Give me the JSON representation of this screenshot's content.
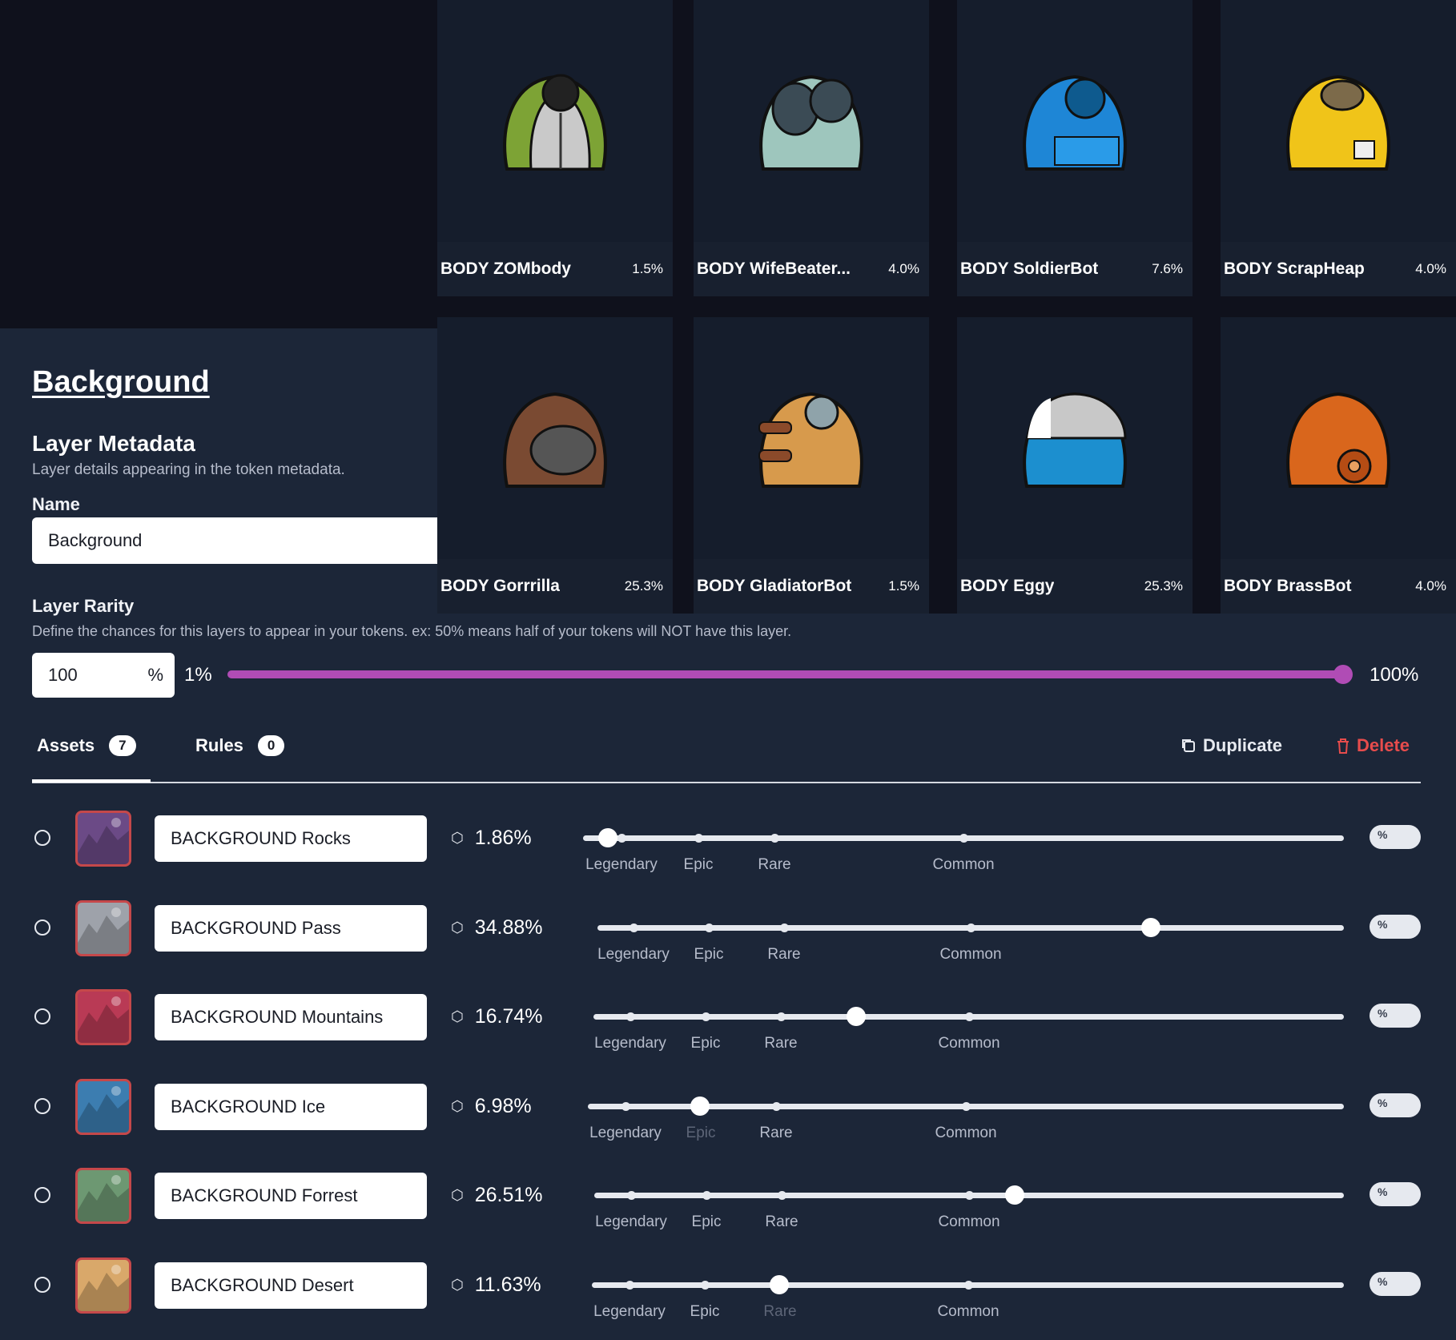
{
  "cards": [
    {
      "name": "BODY ZOMbody",
      "pct": "1.5%"
    },
    {
      "name": "BODY WifeBeater...",
      "pct": "4.0%"
    },
    {
      "name": "BODY SoldierBot",
      "pct": "7.6%"
    },
    {
      "name": "BODY ScrapHeap",
      "pct": "4.0%"
    },
    {
      "name": "BODY Gorrrilla",
      "pct": "25.3%"
    },
    {
      "name": "BODY GladiatorBot",
      "pct": "1.5%"
    },
    {
      "name": "BODY Eggy",
      "pct": "25.3%"
    },
    {
      "name": "BODY BrassBot",
      "pct": "4.0%"
    }
  ],
  "layer": {
    "title": "Background",
    "metadata_heading": "Layer Metadata",
    "metadata_sub": "Layer details appearing in the token metadata.",
    "name_label": "Name",
    "name_value": "Background",
    "rarity_label": "Layer Rarity",
    "rarity_desc": "Define the chances for this layers to appear in your tokens. ex: 50% means half of your tokens will NOT have this layer.",
    "rarity_value": "100",
    "rarity_unit": "%",
    "range_min": "1%",
    "range_max": "100%"
  },
  "tabs": {
    "assets_label": "Assets",
    "assets_count": "7",
    "rules_label": "Rules",
    "rules_count": "0",
    "duplicate_label": "Duplicate",
    "delete_label": "Delete"
  },
  "tier_labels": [
    "Legendary",
    "Epic",
    "Rare",
    "Common"
  ],
  "toggle_label": "%",
  "assets": [
    {
      "name": "BACKGROUND Rocks",
      "rarity": "1.86%",
      "color": "#6b4a86"
    },
    {
      "name": "BACKGROUND Pass",
      "rarity": "34.88%",
      "color": "#9ea2aa"
    },
    {
      "name": "BACKGROUND Mountains",
      "rarity": "16.74%",
      "color": "#b93a55"
    },
    {
      "name": "BACKGROUND Ice",
      "rarity": "6.98%",
      "color": "#3c7db0"
    },
    {
      "name": "BACKGROUND Forrest",
      "rarity": "26.51%",
      "color": "#6d9872"
    },
    {
      "name": "BACKGROUND Desert",
      "rarity": "11.63%",
      "color": "#d9a86a"
    }
  ]
}
